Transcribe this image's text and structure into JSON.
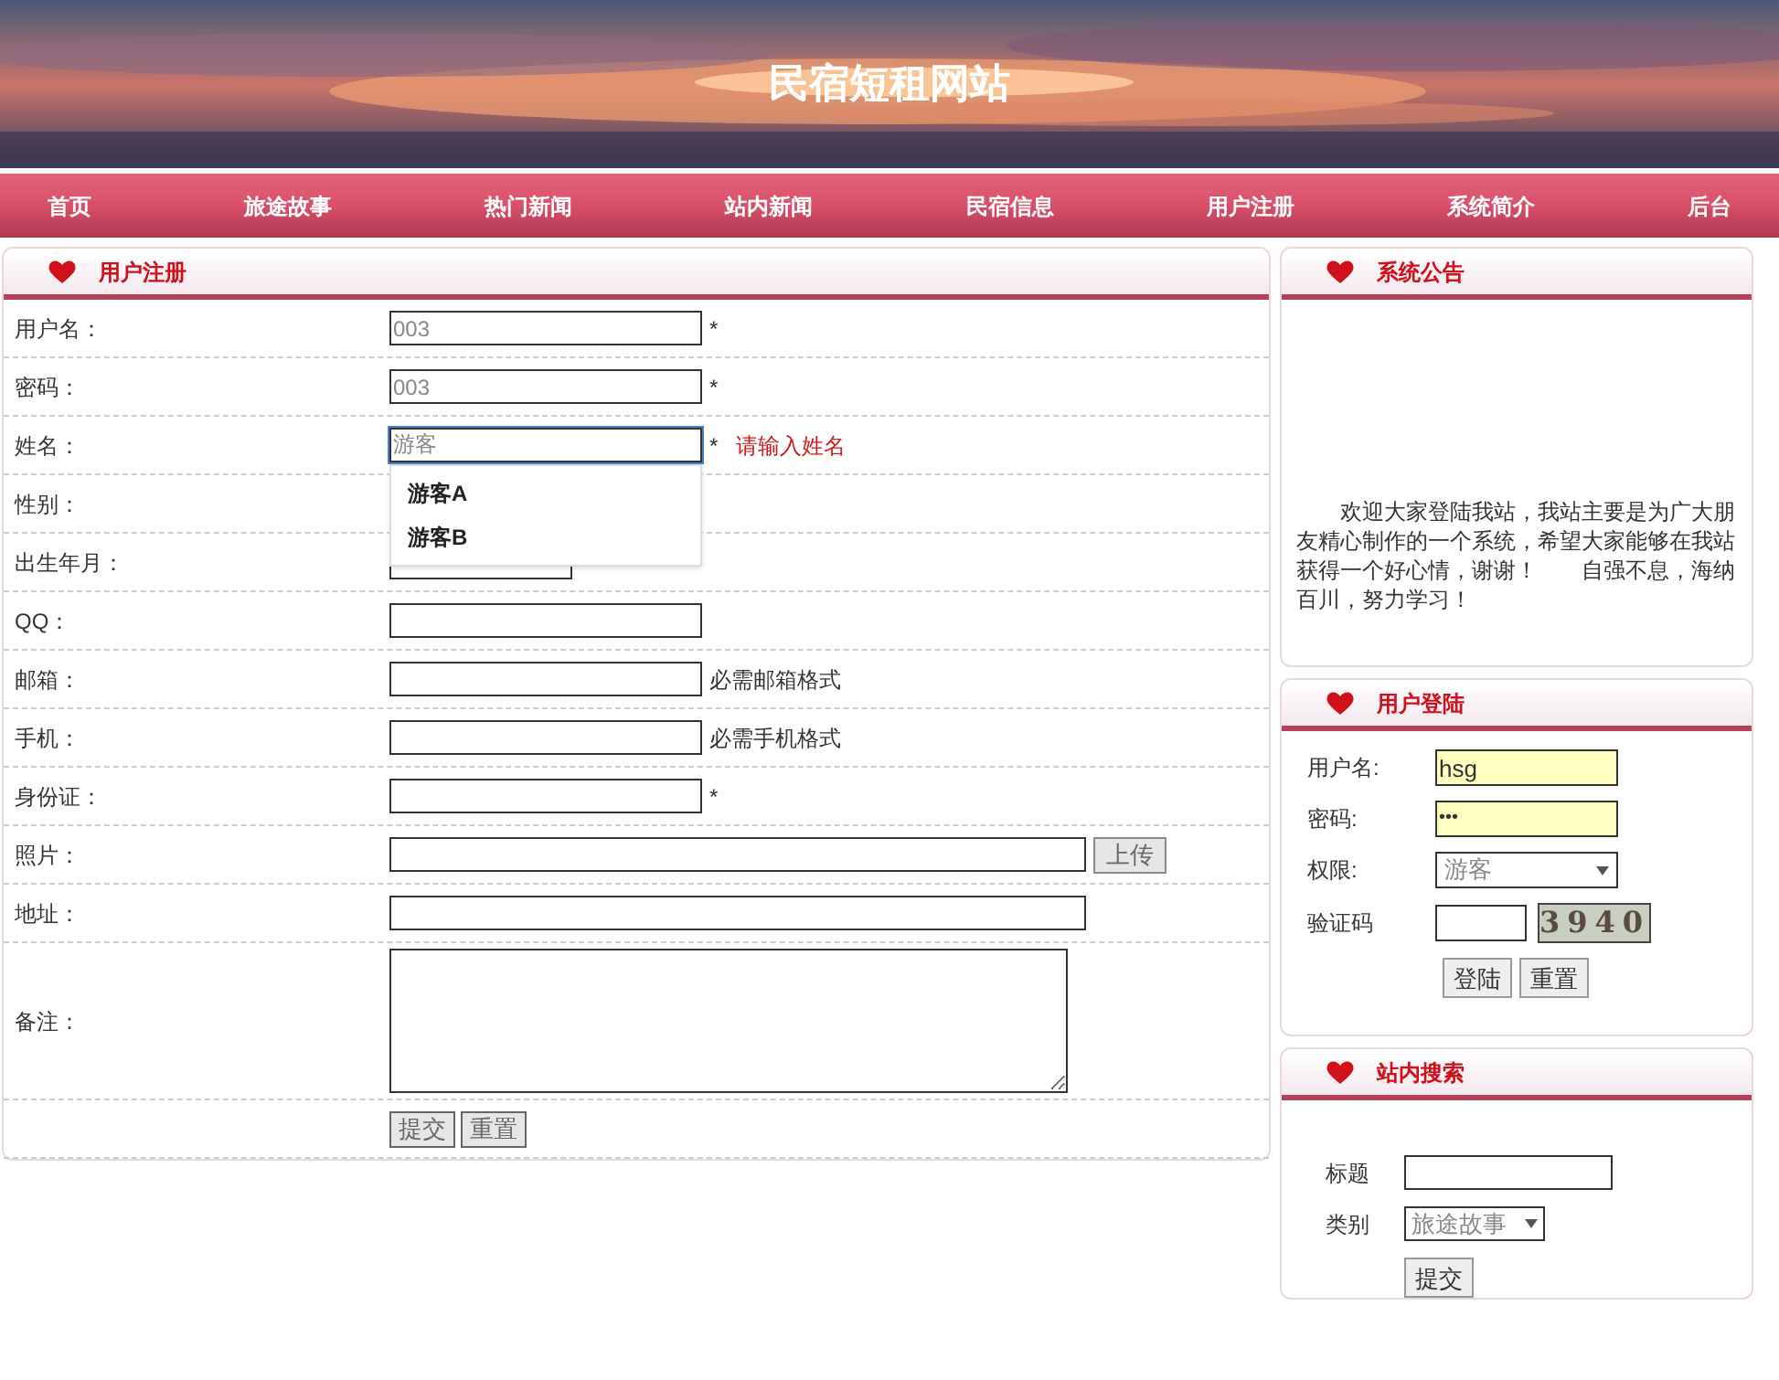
{
  "site_title": "民宿短租网站",
  "nav": [
    "首页",
    "旅途故事",
    "热门新闻",
    "站内新闻",
    "民宿信息",
    "用户注册",
    "系统简介",
    "后台"
  ],
  "register": {
    "title": "用户注册",
    "fields": [
      {
        "kind": "text",
        "label": "用户名：",
        "value": "003",
        "mark": "*"
      },
      {
        "kind": "text",
        "label": "密码：",
        "value": "003",
        "mark": "*"
      },
      {
        "kind": "text",
        "label": "姓名：",
        "value": "游客",
        "mark": "*",
        "error": "请输入姓名",
        "focused": true,
        "suggestions": [
          "游客A",
          "游客B"
        ]
      },
      {
        "kind": "hidden",
        "label": "性别："
      },
      {
        "kind": "short",
        "label": "出生年月："
      },
      {
        "kind": "text",
        "label": "QQ："
      },
      {
        "kind": "text",
        "label": "邮箱：",
        "note": "必需邮箱格式"
      },
      {
        "kind": "text",
        "label": "手机：",
        "note": "必需手机格式"
      },
      {
        "kind": "text",
        "label": "身份证：",
        "mark": "*"
      },
      {
        "kind": "file",
        "label": "照片：",
        "button": "上传"
      },
      {
        "kind": "wide",
        "label": "地址："
      },
      {
        "kind": "textarea",
        "label": "备注："
      }
    ],
    "buttons": [
      "提交",
      "重置"
    ]
  },
  "notice": {
    "title": "系统公告",
    "text": "欢迎大家登陆我站，我站主要是为广大朋友精心制作的一个系统，希望大家能够在我站获得一个好心情，谢谢！　　自强不息，海纳百川，努力学习！"
  },
  "login": {
    "title": "用户登陆",
    "username_label": "用户名:",
    "username": "hsg",
    "password_label": "密码:",
    "password": "•••",
    "role_label": "权限:",
    "role": "游客",
    "captcha_label": "验证码",
    "captcha": "3940",
    "buttons": [
      "登陆",
      "重置"
    ]
  },
  "search": {
    "title": "站内搜索",
    "title_label": "标题",
    "category_label": "类别",
    "category": "旅途故事",
    "button": "提交"
  }
}
